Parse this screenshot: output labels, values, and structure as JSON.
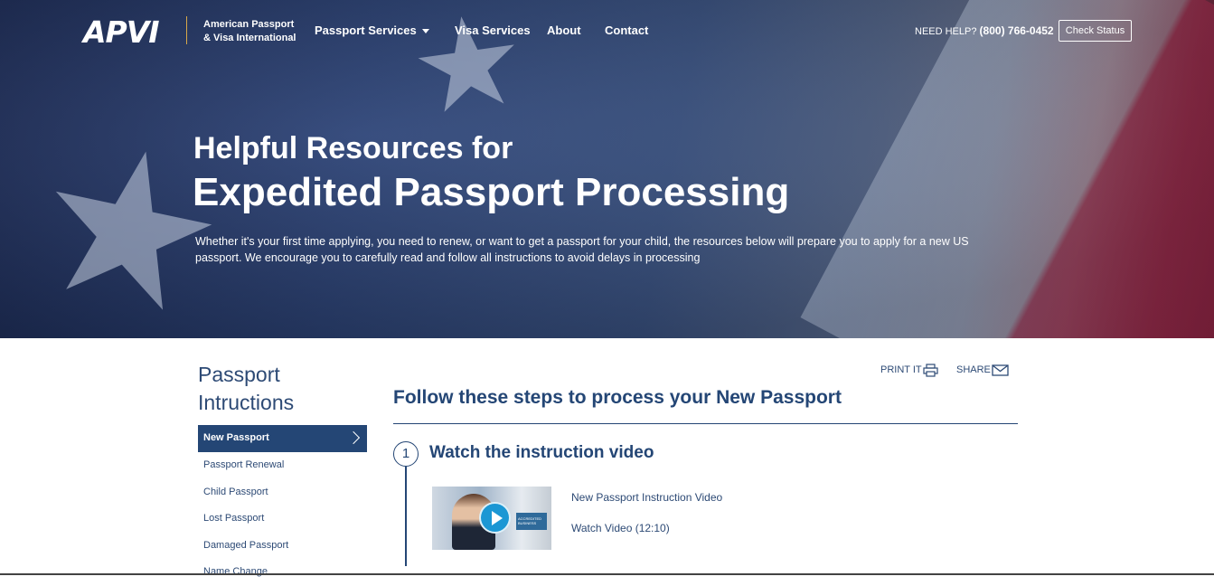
{
  "header": {
    "logo_text": "APVI",
    "brand_line1": "American Passport",
    "brand_line2": "& Visa International",
    "nav": [
      {
        "label": "Passport Services"
      },
      {
        "label": "Visa Services"
      },
      {
        "label": "About"
      },
      {
        "label": "Contact"
      }
    ],
    "help_label": "NEED HELP?",
    "help_phone": "(800) 766-0452",
    "check_status": "Check Status"
  },
  "hero": {
    "title_small": "Helpful Resources for",
    "title_big": "Expedited Passport Processing",
    "lead": "Whether it's your first time applying, you need to renew, or want to get a passport for your child, the resources below will prepare you to apply for a new US passport. We encourage you to carefully read and follow all instructions to avoid delays in processing"
  },
  "sidebar": {
    "title": "Passport Intructions",
    "items": [
      {
        "label": "New Passport",
        "active": true
      },
      {
        "label": "Passport Renewal"
      },
      {
        "label": "Child Passport"
      },
      {
        "label": "Lost Passport"
      },
      {
        "label": "Damaged Passport"
      },
      {
        "label": "Name Change"
      }
    ]
  },
  "main": {
    "print_label": "PRINT IT",
    "share_label": "SHARE",
    "title": "Follow these steps to process your New Passport",
    "step_number": "1",
    "step_title": "Watch the instruction video",
    "video_badge": "ACCREDITED BUSINESS",
    "video_title": "New Passport Instruction Video",
    "video_link": "Watch Video (12:10)"
  },
  "colors": {
    "accent": "#244675",
    "divider_gold": "#d8a94a",
    "play_blue": "#1b97d4"
  }
}
